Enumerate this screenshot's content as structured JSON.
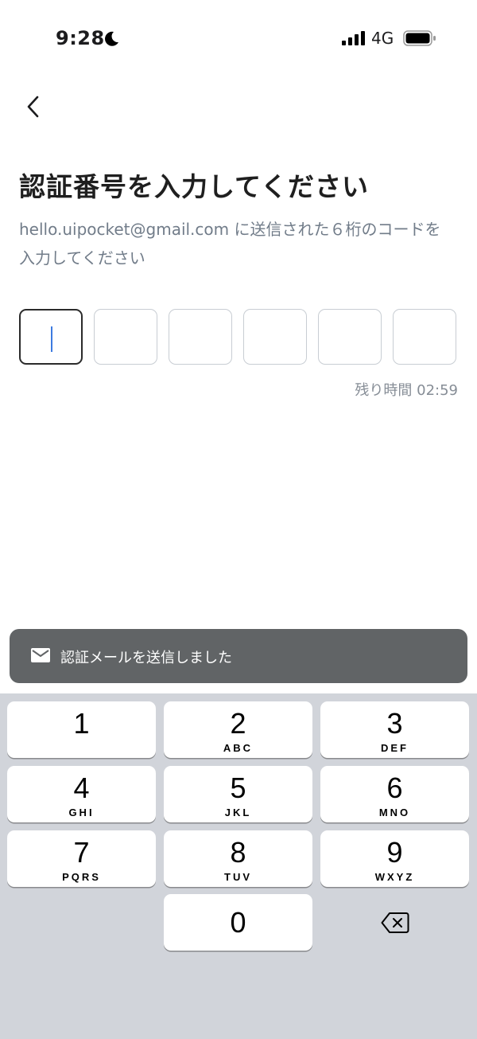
{
  "status_bar": {
    "time": "9:28",
    "network": "4G"
  },
  "header": {
    "title": "認証番号を入力してください",
    "subtitle": "hello.uipocket@gmail.com に送信された６桁のコードを入力してください"
  },
  "otp": {
    "length": 6,
    "active_index": 0,
    "timer": "残り時間 02:59"
  },
  "toast": {
    "text": "認証メールを送信しました",
    "icon": "mail-icon"
  },
  "keyboard": {
    "keys": [
      {
        "num": "1",
        "letters": ""
      },
      {
        "num": "2",
        "letters": "ABC"
      },
      {
        "num": "3",
        "letters": "DEF"
      },
      {
        "num": "4",
        "letters": "GHI"
      },
      {
        "num": "5",
        "letters": "JKL"
      },
      {
        "num": "6",
        "letters": "MNO"
      },
      {
        "num": "7",
        "letters": "PQRS"
      },
      {
        "num": "8",
        "letters": "TUV"
      },
      {
        "num": "9",
        "letters": "WXYZ"
      },
      {
        "num": "0",
        "letters": ""
      }
    ],
    "delete_icon": "backspace-icon"
  },
  "colors": {
    "accent_caret": "#3d7be0",
    "toast_bg": "#616466",
    "keyboard_bg": "#d1d4da",
    "subtitle": "#717c89"
  }
}
